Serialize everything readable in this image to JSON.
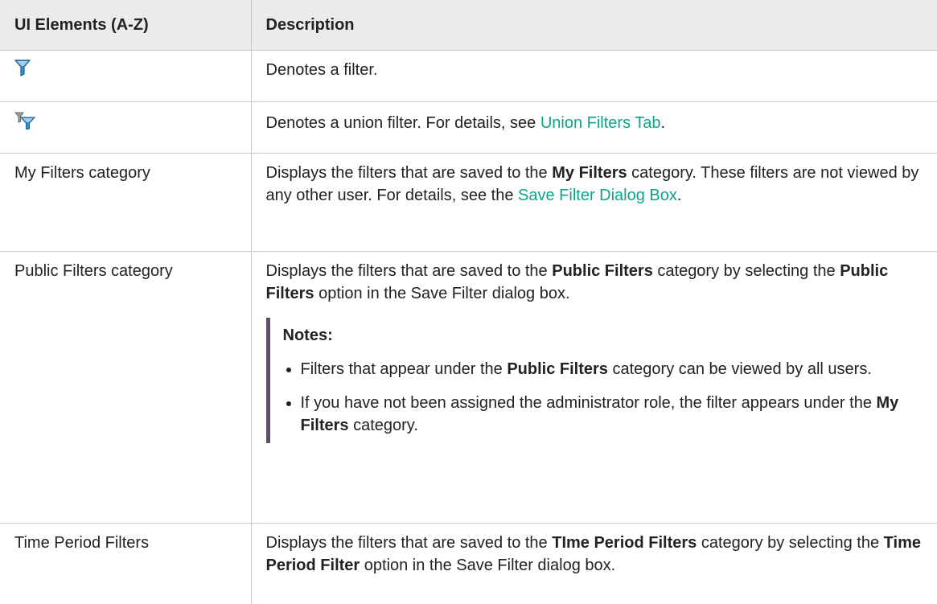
{
  "header": {
    "col1": "UI Elements (A-Z)",
    "col2": "Description"
  },
  "rows": {
    "filter_icon": {
      "icon": "filter-icon",
      "desc": "Denotes a filter."
    },
    "union_icon": {
      "icon": "union-filter-icon",
      "desc_pre": "Denotes a union filter. For details, see ",
      "link": "Union Filters Tab",
      "desc_post": "."
    },
    "my_filters": {
      "name": "My Filters category",
      "t1": "Displays the filters that are saved to the ",
      "b1": "My Filters",
      "t2": " category. These filters are not viewed by any other user. For details, see the ",
      "link": "Save Filter Dialog Box",
      "t3": "."
    },
    "public_filters": {
      "name": "Public Filters category",
      "t1": "Displays the filters that are saved to the ",
      "b1": "Public Filters",
      "t2": " category by selecting the ",
      "b2": "Public Filters",
      "t3": " option in the Save Filter dialog box.",
      "notes_title": "Notes:",
      "note1_pre": "Filters that appear under the ",
      "note1_bold": "Public Filters",
      "note1_post": " category can be viewed by all users.",
      "note2_pre": "If you have not been assigned the administrator role, the filter appears under the ",
      "note2_bold": "My Filters",
      "note2_post": " category."
    },
    "time_filters": {
      "name": "Time Period Filters",
      "t1": "Displays the filters that are saved to the ",
      "b1": "TIme Period Filters",
      "t2": " category by selecting the ",
      "b2": "Time Period Filter",
      "t3": " option in the Save Filter dialog box."
    }
  },
  "colors": {
    "link": "#0fa389",
    "header_bg": "#ebebeb",
    "notes_bar": "#5e4b6d",
    "filter_icon": "#3a8fc9"
  }
}
